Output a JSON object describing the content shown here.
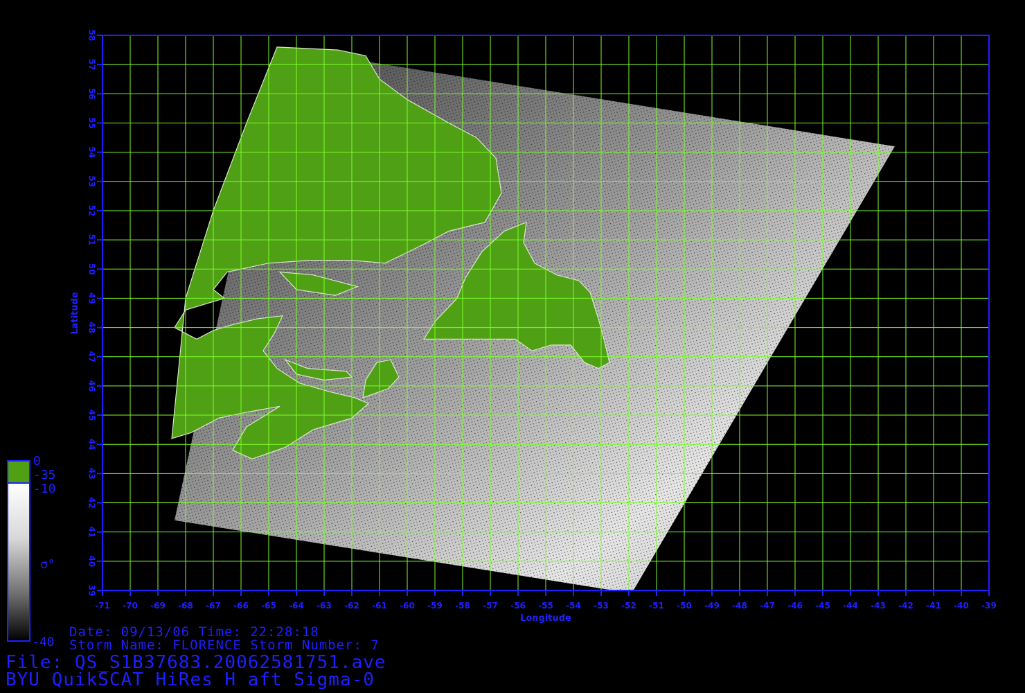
{
  "map": {
    "lon_range": [
      -71,
      -39
    ],
    "lat_range": [
      39,
      58
    ],
    "xlabel": "Longitude",
    "ylabel": "Latitude",
    "x_ticks": [
      -71,
      -70,
      -69,
      -68,
      -67,
      -66,
      -65,
      -64,
      -63,
      -62,
      -61,
      -60,
      -59,
      -58,
      -57,
      -56,
      -55,
      -54,
      -53,
      -52,
      -51,
      -50,
      -49,
      -48,
      -47,
      -46,
      -45,
      -44,
      -43,
      -42,
      -41,
      -40,
      -39
    ],
    "y_ticks": [
      39,
      40,
      41,
      42,
      43,
      44,
      45,
      46,
      47,
      48,
      49,
      50,
      51,
      52,
      53,
      54,
      55,
      56,
      57,
      58
    ],
    "grid": true,
    "colors": {
      "axis": "#1f1fff",
      "grid": "#7cff2a",
      "land": "#4fa014",
      "background": "#000000"
    },
    "swath_corners": [
      [
        -64.7,
        57.6
      ],
      [
        -42.4,
        54.2
      ],
      [
        -51.9,
        38.9
      ],
      [
        -68.4,
        41.4
      ]
    ]
  },
  "colorbar": {
    "top_label": "0",
    "mid_label_1": "-35",
    "mid_label_2": "-10",
    "symbol_label": "σ°",
    "bottom_label": "-40"
  },
  "info": {
    "date_line": "Date: 09/13/06  Time: 22:28:18",
    "storm_line": "Storm Name: FLORENCE  Storm Number: 7",
    "file_line": "File: QS_S1B37683.20062581751.ave",
    "title_line": "BYU QuikSCAT HiRes H aft Sigma-0"
  }
}
